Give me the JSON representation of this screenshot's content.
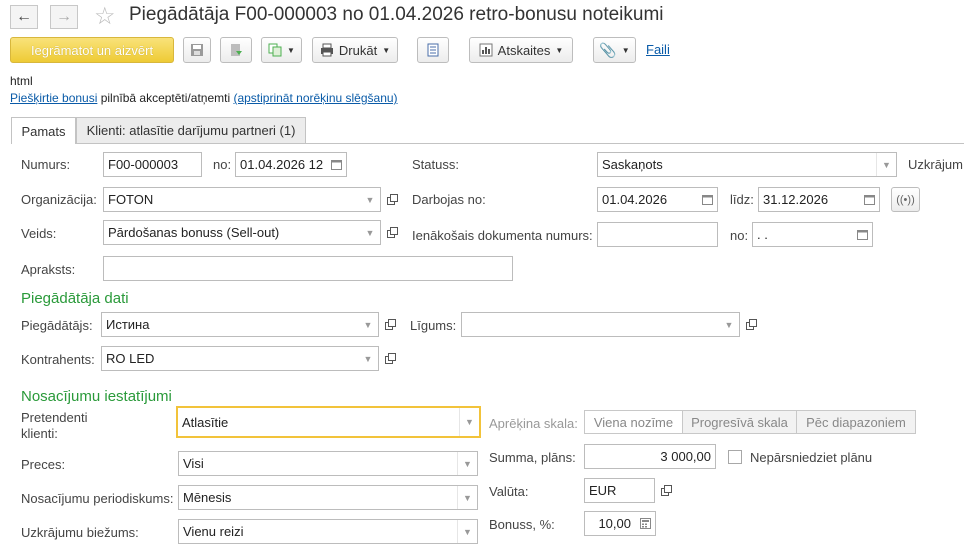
{
  "window": {
    "title": "Piegādātāja   F00-000003 no 01.04.2026 retro-bonusu noteikumi"
  },
  "toolbar": {
    "post_close_label": "Iegrāmatot un aizvērt",
    "print_label": "Drukāt",
    "reports_label": "Atskaites",
    "files_label": "Faili"
  },
  "info": {
    "html_text": "html",
    "bonus_link": "Piešķirtie bonusi",
    "bonus_text": " pilnībā akceptēti/atņemti ",
    "approve_link": "(apstiprināt norēķinu slēgšanu)"
  },
  "tabs": [
    {
      "label": "Pamats",
      "active": true
    },
    {
      "label": "Klienti: atlasītie darījumu partneri (1)",
      "active": false
    }
  ],
  "form": {
    "number_label": "Numurs:",
    "number_value": "F00-000003",
    "no_label": "no:",
    "date_value": "01.04.2026 12:",
    "status_label": "Statuss:",
    "status_value": "Saskaņots",
    "accum_label": "Uzkrājum",
    "org_label": "Organizācija:",
    "org_value": "FOTON",
    "active_from_label": "Darbojas no:",
    "active_from_value": "01.04.2026",
    "to_label": "līdz:",
    "to_value": "31.12.2026",
    "type_label": "Veids:",
    "type_value": "Pārdošanas bonuss (Sell-out)",
    "incoming_doc_label": "Ienākošais dokumenta numurs:",
    "incoming_doc_value": "",
    "incoming_no_label": "no:",
    "incoming_date_value": " .  .",
    "desc_label": "Apraksts:",
    "desc_value": ""
  },
  "supplier_section": {
    "title": "Piegādātāja dati",
    "supplier_label": "Piegādātājs:",
    "supplier_value": "Истина",
    "contract_label": "Līgums:",
    "contract_value": "",
    "counterparty_label": "Kontrahents:",
    "counterparty_value": "RO LED"
  },
  "conditions_section": {
    "title": "Nosacījumu iestatījumi",
    "claimants_label": "Pretendenti klienti:",
    "claimants_value": "Atlasītie",
    "scale_label": "Aprēķina skala:",
    "scale_options": [
      "Viena nozīme",
      "Progresīvā skala",
      "Pēc diapazoniem"
    ],
    "goods_label": "Preces:",
    "goods_value": "Visi",
    "plan_label": "Summa, plāns:",
    "plan_value": "3 000,00",
    "dont_exceed_label": "Nepārsniedziet plānu",
    "dont_exceed_checked": false,
    "period_label": "Nosacījumu periodiskums:",
    "period_value": "Mēnesis",
    "currency_label": "Valūta:",
    "currency_value": "EUR",
    "freq_label": "Uzkrājumu biežums:",
    "freq_value": "Vienu reizi",
    "bonus_label": "Bonuss, %:",
    "bonus_value": "10,00"
  },
  "colors": {
    "primary_button": "#eecb35",
    "section_title": "#2a9a3a",
    "link": "#0a5ba8",
    "focus_border": "#f2c33a"
  }
}
